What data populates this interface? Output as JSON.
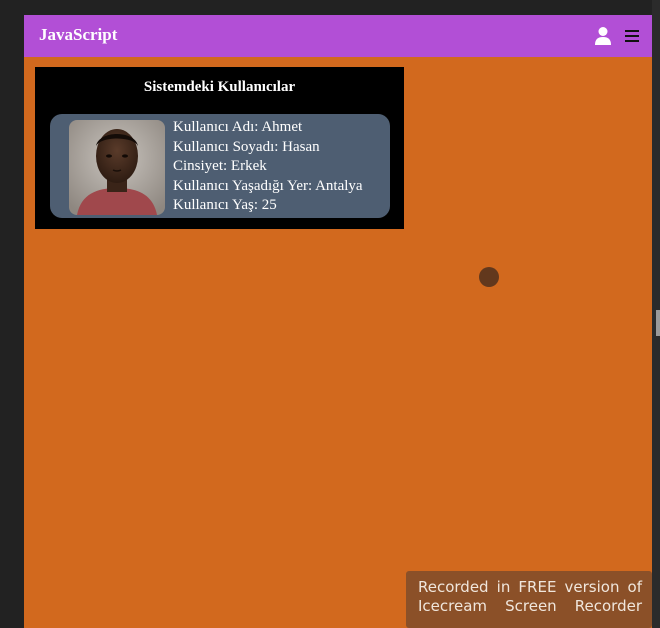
{
  "navbar": {
    "brand": "JavaScript",
    "user_icon": "user-icon",
    "menu_icon": "hamburger-menu-icon",
    "color": "#b24fd6"
  },
  "page": {
    "background": "#d2691e"
  },
  "users_panel": {
    "title": "Sistemdeki Kullanıcılar",
    "users": [
      {
        "name_line": "Kullanıcı Adı: Ahmet",
        "surname_line": "Kullanıcı Soyadı: Hasan",
        "gender_line": "Cinsiyet: Erkek",
        "location_line": "Kullanıcı Yaşadığı Yer: Antalya",
        "age_line": "Kullanıcı Yaş: 25",
        "avatar": "user-photo"
      }
    ]
  },
  "watermark": {
    "line1": "Recorded in FREE version of",
    "line2": "Icecream Screen Recorder"
  }
}
